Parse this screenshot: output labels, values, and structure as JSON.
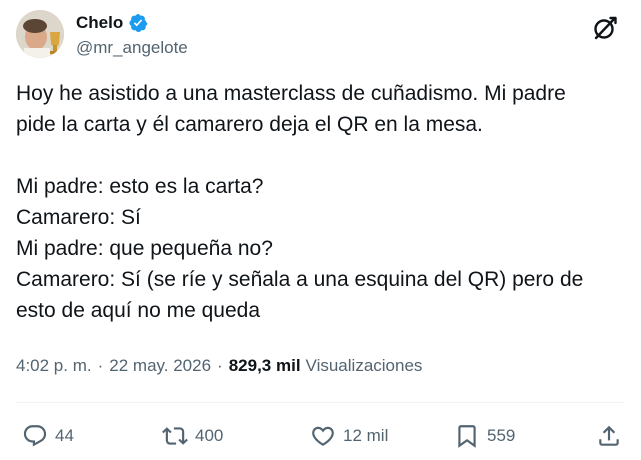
{
  "author": {
    "display_name": "Chelo",
    "handle": "@mr_angelote",
    "verified": true
  },
  "tweet": {
    "intro_lines": [
      "Hoy he asistido a una masterclass de cuñadismo. Mi padre",
      "pide la carta y él camarero deja el QR en la mesa."
    ],
    "dialogue_lines": [
      "Mi padre: esto es la carta?",
      "Camarero: Sí",
      "Mi padre: que pequeña no?",
      "Camarero: Sí (se ríe y señala a una esquina del QR) pero de",
      "esto de aquí no me queda"
    ]
  },
  "meta": {
    "time": "4:02 p. m.",
    "separator": "·",
    "date": "22 may. 2026",
    "views_count": "829,3 mil",
    "views_label": "Visualizaciones"
  },
  "actions": {
    "replies": "44",
    "reposts": "400",
    "likes": "12 mil",
    "bookmarks": "559"
  },
  "icons": {
    "verified": "verified-badge-icon",
    "grok": "grok-icon",
    "reply": "reply-icon",
    "repost": "repost-icon",
    "like": "heart-icon",
    "bookmark": "bookmark-icon",
    "share": "share-icon"
  },
  "colors": {
    "verified_blue": "#1d9bf0",
    "text_primary": "#0f1419",
    "text_secondary": "#536471",
    "divider": "#eff3f4"
  }
}
